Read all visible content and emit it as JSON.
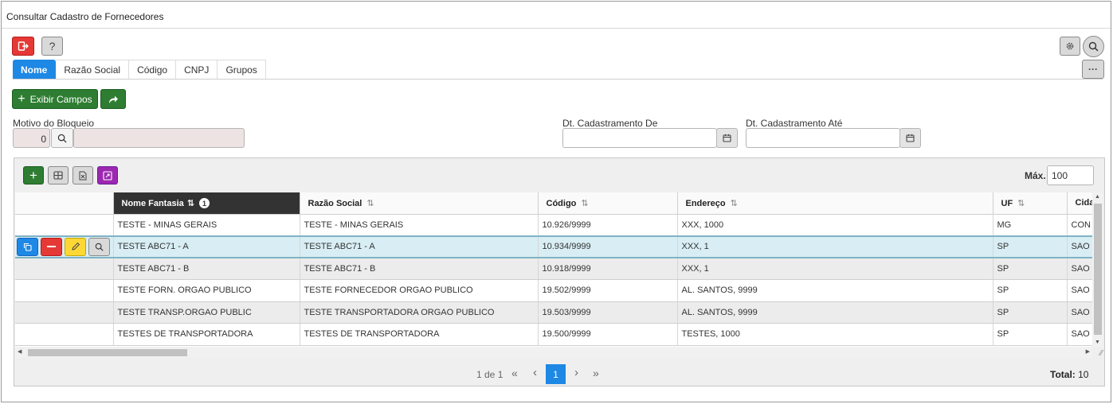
{
  "window": {
    "title": "Consultar Cadastro de Fornecedores"
  },
  "toolbar": {
    "help_label": "?",
    "more_label": "···"
  },
  "tabs": [
    "Nome",
    "Razão Social",
    "Código",
    "CNPJ",
    "Grupos"
  ],
  "actions": {
    "exibir_campos_label": "Exibir Campos"
  },
  "filters": {
    "motivo_label": "Motivo do Bloqueio",
    "motivo_code": "0",
    "dt_de_label": "Dt. Cadastramento De",
    "dt_ate_label": "Dt. Cadastramento Até"
  },
  "grid": {
    "max_label": "Máx.",
    "max_value": "100",
    "columns": [
      "Nome Fantasia",
      "Razão Social",
      "Código",
      "Endereço",
      "UF",
      "Cida"
    ],
    "sort_badge": "1",
    "rows": [
      [
        "TESTE - MINAS GERAIS",
        "TESTE - MINAS GERAIS",
        "10.926/9999",
        "XXX, 1000",
        "MG",
        "CON"
      ],
      [
        "TESTE ABC71 - A",
        "TESTE ABC71 - A",
        "10.934/9999",
        "XXX, 1",
        "SP",
        "SAO"
      ],
      [
        "TESTE ABC71 - B",
        "TESTE ABC71 - B",
        "10.918/9999",
        "XXX, 1",
        "SP",
        "SAO"
      ],
      [
        "TESTE FORN. ORGAO PUBLICO",
        "TESTE FORNECEDOR ORGAO PUBLICO",
        "19.502/9999",
        "AL. SANTOS, 9999",
        "SP",
        "SAO"
      ],
      [
        "TESTE TRANSP.ORGAO PUBLIC",
        "TESTE TRANSPORTADORA ORGAO PUBLICO",
        "19.503/9999",
        "AL. SANTOS, 9999",
        "SP",
        "SAO"
      ],
      [
        "TESTES DE TRANSPORTADORA",
        "TESTES DE TRANSPORTADORA",
        "19.500/9999",
        "TESTES, 1000",
        "SP",
        "SAO"
      ]
    ]
  },
  "pager": {
    "page_info": "1 de 1",
    "first": "«",
    "prev": "‹",
    "current": "1",
    "next": "›",
    "last": "»",
    "total_label": "Total:",
    "total_value": "10"
  },
  "colors": {
    "primary": "#1e88e5",
    "danger": "#e53935",
    "success": "#2e7d32",
    "selected_row": "#d8eef4"
  }
}
